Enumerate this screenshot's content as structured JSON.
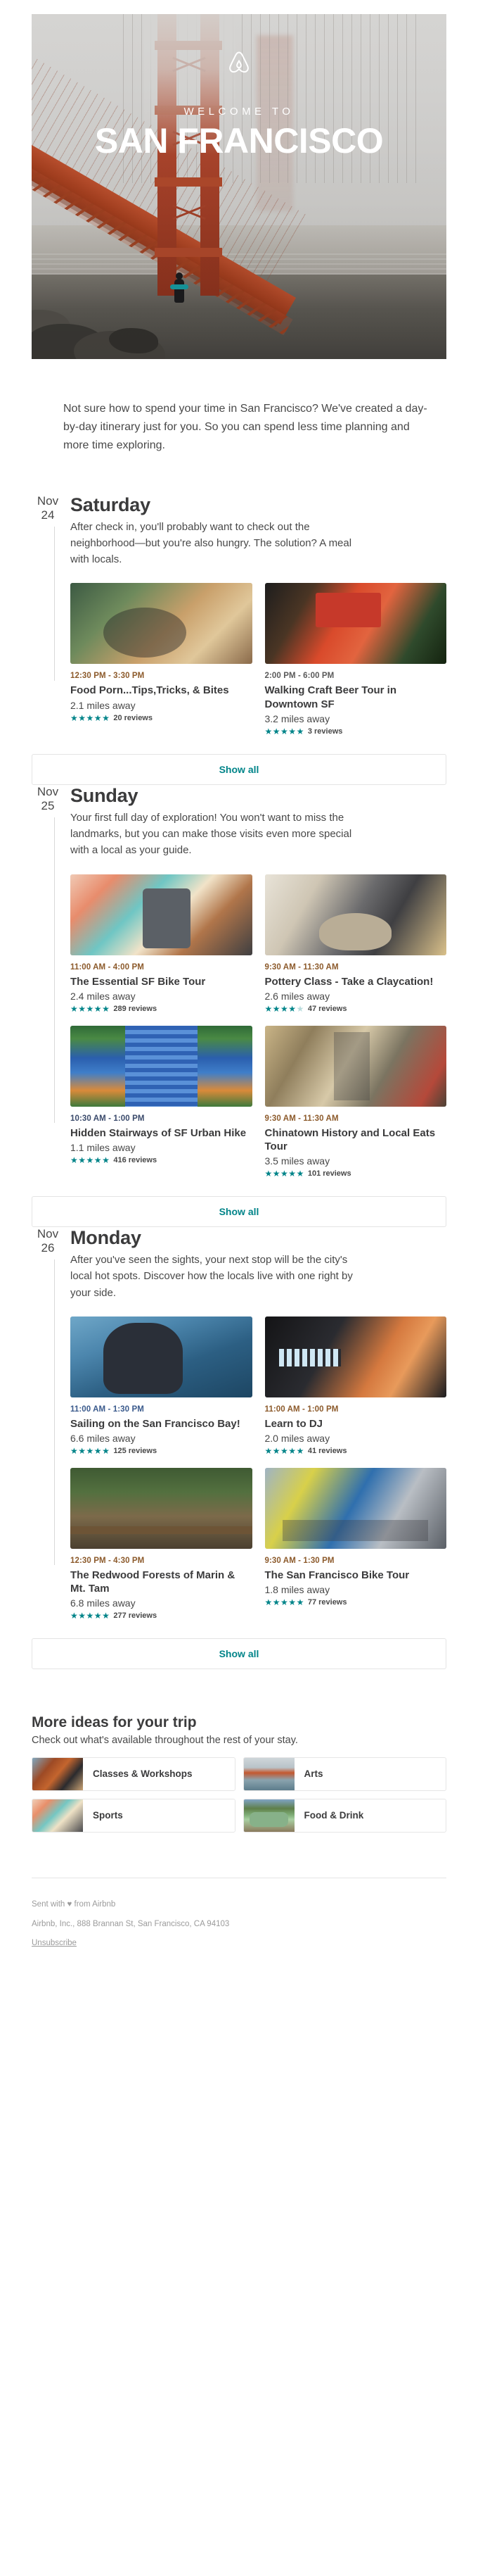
{
  "hero": {
    "logo_icon": "airbnb-belo-icon",
    "kicker": "WELCOME TO",
    "title": "SAN FRANCISCO"
  },
  "intro": {
    "text": "Not sure how to spend your time in San Francisco? We've created a day-by-day itinerary just for you. So you can spend less time planning and more time exploring."
  },
  "show_all_label": "Show all",
  "days": [
    {
      "month": "Nov",
      "day_number": "24",
      "name": "Saturday",
      "description": "After check in, you'll probably want to check out the neighborhood—but you're also hungry. The solution? A meal with locals.",
      "cards": [
        {
          "image": "ph-food",
          "time": "12:30 PM - 3:30 PM",
          "time_color": "#8c5a2b",
          "title": "Food Porn...Tips,Tricks, & Bites",
          "distance": "2.1 miles away",
          "stars": 5,
          "reviews": "20 reviews"
        },
        {
          "image": "ph-beer",
          "time": "2:00 PM - 6:00 PM",
          "time_color": "#5a5a5a",
          "title": "Walking Craft Beer Tour in Downtown SF",
          "distance": "3.2 miles away",
          "stars": 5,
          "reviews": "3 reviews"
        }
      ]
    },
    {
      "month": "Nov",
      "day_number": "25",
      "name": "Sunday",
      "description": "Your first full day of exploration! You won't want to miss the landmarks, but you can make those visits even more special with a local as your guide.",
      "cards": [
        {
          "image": "ph-bike",
          "time": "11:00 AM - 4:00 PM",
          "time_color": "#8c5a2b",
          "title": "The Essential SF Bike Tour",
          "distance": "2.4 miles away",
          "stars": 5,
          "reviews": "289 reviews"
        },
        {
          "image": "ph-pottery",
          "time": "9:30 AM - 11:30 AM",
          "time_color": "#8c5a2b",
          "title": "Pottery Class - Take a Claycation!",
          "distance": "2.6 miles away",
          "stars": 4.5,
          "reviews": "47 reviews"
        },
        {
          "image": "ph-stairs",
          "time": "10:30 AM - 1:00 PM",
          "time_color": "#3a4a6b",
          "title": "Hidden Stairways of SF Urban Hike",
          "distance": "1.1 miles away",
          "stars": 5,
          "reviews": "416 reviews"
        },
        {
          "image": "ph-chinatown",
          "time": "9:30 AM - 11:30 AM",
          "time_color": "#8c5a2b",
          "title": "Chinatown History and Local Eats Tour",
          "distance": "3.5 miles away",
          "stars": 5,
          "reviews": "101 reviews"
        }
      ]
    },
    {
      "month": "Nov",
      "day_number": "26",
      "name": "Monday",
      "description": "After you've seen the sights, your next stop will be the city's local hot spots. Discover how the locals live with one right by your side.",
      "cards": [
        {
          "image": "ph-sail",
          "time": "11:00 AM - 1:30 PM",
          "time_color": "#3a5a8c",
          "title": "Sailing on the San Francisco Bay!",
          "distance": "6.6 miles away",
          "stars": 5,
          "reviews": "125 reviews"
        },
        {
          "image": "ph-dj",
          "time": "11:00 AM - 1:00 PM",
          "time_color": "#8c5a2b",
          "title": "Learn to DJ",
          "distance": "2.0 miles away",
          "stars": 5,
          "reviews": "41 reviews"
        },
        {
          "image": "ph-redwood",
          "time": "12:30 PM - 4:30 PM",
          "time_color": "#8c5a2b",
          "title": "The Redwood Forests of Marin & Mt. Tam",
          "distance": "6.8 miles away",
          "stars": 5,
          "reviews": "277 reviews"
        },
        {
          "image": "ph-sfbike",
          "time": "9:30 AM - 1:30 PM",
          "time_color": "#8c5a2b",
          "title": "The San Francisco Bike Tour",
          "distance": "1.8 miles away",
          "stars": 5,
          "reviews": "77 reviews"
        }
      ]
    }
  ],
  "more": {
    "title": "More ideas for your trip",
    "subtitle": "Check out what's available throughout the rest of your stay.",
    "tiles": [
      {
        "image": "ph-crab",
        "label": "Classes & Workshops"
      },
      {
        "image": "ph-arts",
        "label": "Arts"
      },
      {
        "image": "ph-sports",
        "label": "Sports"
      },
      {
        "image": "ph-vw",
        "label": "Food & Drink"
      }
    ]
  },
  "footer": {
    "sent_with": "Sent with ♥ from Airbnb",
    "address": "Airbnb, Inc., 888 Brannan St, San Francisco, CA 94103",
    "unsubscribe": "Unsubscribe"
  }
}
